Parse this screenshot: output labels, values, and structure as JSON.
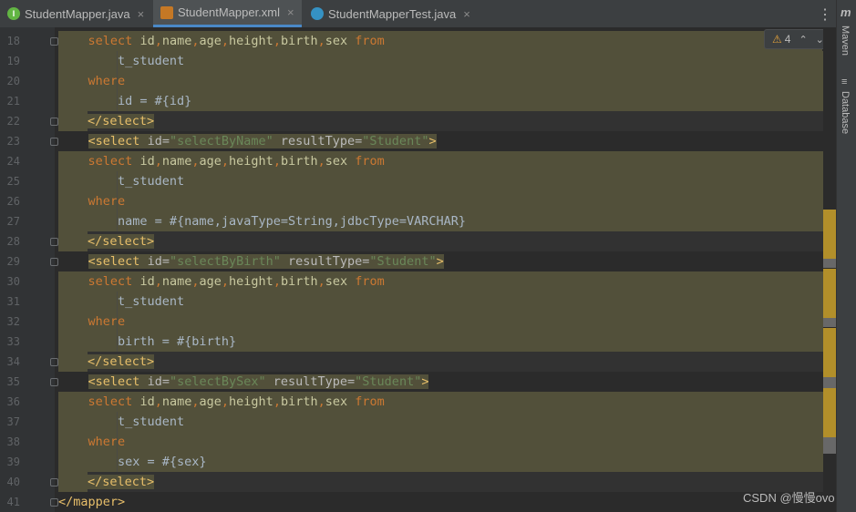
{
  "tabs": [
    {
      "label": "StudentMapper.java",
      "icon": "interface-icon",
      "icon_letter": "I",
      "close": "×"
    },
    {
      "label": "StudentMapper.xml",
      "icon": "xml-file-icon",
      "close": "×"
    },
    {
      "label": "StudentMapperTest.java",
      "icon": "class-icon",
      "close": "×"
    }
  ],
  "menu_glyph": "⋮",
  "warnings": {
    "icon": "⚠",
    "count": "4",
    "up": "⌃",
    "down": "⌄"
  },
  "right_panel": {
    "maven": "Maven",
    "database": "Database",
    "maven_icon": "m",
    "db_icon": "≡"
  },
  "line_numbers": [
    "18",
    "19",
    "20",
    "21",
    "22",
    "23",
    "24",
    "25",
    "26",
    "27",
    "28",
    "29",
    "30",
    "31",
    "32",
    "33",
    "34",
    "35",
    "36",
    "37",
    "38",
    "39",
    "40",
    "41"
  ],
  "code": {
    "select": "select",
    "cols": [
      ",",
      "id",
      ",",
      "name",
      ",",
      "age",
      ",",
      "height",
      ",",
      "birth",
      ",",
      "sex"
    ],
    "from": "from",
    "table": "t_student",
    "where": "where",
    "close_select": "</select>",
    "open_select": "<select",
    "id_attr": "id=",
    "result_attr": "resultType=",
    "student": "\"Student\"",
    "gt": ">",
    "by_name": "\"selectByName\"",
    "by_birth": "\"selectByBirth\"",
    "by_sex": "\"selectBySex\"",
    "cond_id": "id = #{id}",
    "cond_name": "name = #{name,javaType=String,jdbcType=VARCHAR}",
    "cond_birth": "birth = #{birth}",
    "cond_sex": "sex = #{sex}",
    "close_mapper": "</mapper>"
  },
  "watermark": "CSDN @慢慢ovo",
  "colors": {
    "keyword": "#cc7832",
    "tag": "#e8bf6a",
    "string": "#6a8759",
    "highlight": "#52503a",
    "warning": "#e2a13a"
  }
}
